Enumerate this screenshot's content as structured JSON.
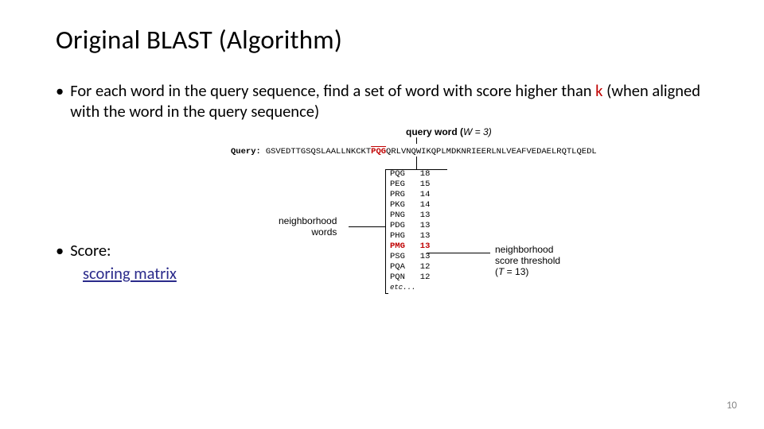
{
  "title": "Original BLAST (Algorithm)",
  "bullet1_prefix": "For each word in the query sequence, find a set of word with score higher than ",
  "bullet1_k": "k",
  "bullet1_suffix": " (when aligned with the word in the query sequence)",
  "score_label": "Score:",
  "scoring_link": "scoring matrix",
  "diagram": {
    "query_word_label": "query word (",
    "query_word_w": "W",
    "query_word_eq": " = 3)",
    "query_label": "Query:",
    "query_seq_left": "GSVEDTTGSQSLAALLNKCKT",
    "query_seq_mid": "PQG",
    "query_seq_right": "QRLVNQWIKQPLMDKNRIEERLNLVEAFVEDAELRQTLQEDL",
    "neighborhood_words_l1": "neighborhood",
    "neighborhood_words_l2": "words",
    "threshold_l1": "neighborhood",
    "threshold_l2": "score threshold",
    "threshold_l3_open": "(",
    "threshold_l3_t": "T",
    "threshold_l3_rest": " = 13)",
    "rows": [
      {
        "w": "PQG",
        "s": "18",
        "hl": false
      },
      {
        "w": "PEG",
        "s": "15",
        "hl": false
      },
      {
        "w": "PRG",
        "s": "14",
        "hl": false
      },
      {
        "w": "PKG",
        "s": "14",
        "hl": false
      },
      {
        "w": "PNG",
        "s": "13",
        "hl": false
      },
      {
        "w": "PDG",
        "s": "13",
        "hl": false
      },
      {
        "w": "PHG",
        "s": "13",
        "hl": false
      },
      {
        "w": "PMG",
        "s": "13",
        "hl": true
      },
      {
        "w": "PSG",
        "s": "13",
        "hl": false
      },
      {
        "w": "PQA",
        "s": "12",
        "hl": false
      },
      {
        "w": "PQN",
        "s": "12",
        "hl": false
      }
    ],
    "etc": "etc..."
  },
  "page_number": "10"
}
